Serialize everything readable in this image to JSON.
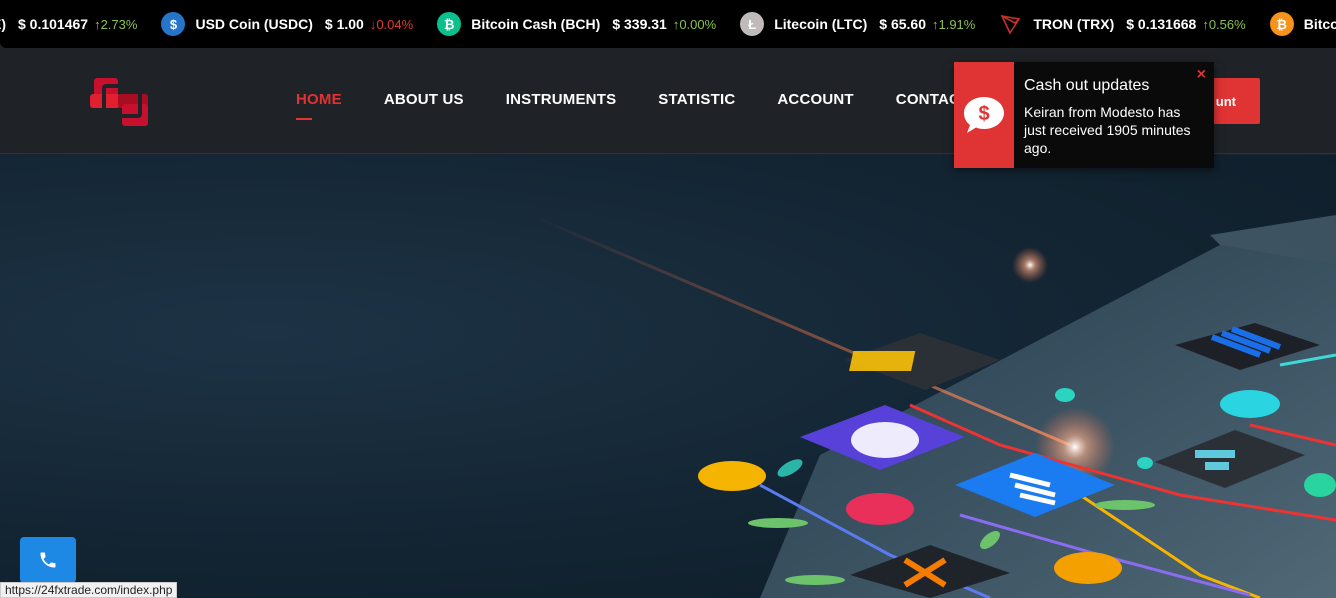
{
  "ticker": [
    {
      "name": "E)",
      "price": "$ 0.101467",
      "change": "2.73%",
      "dir": "up",
      "icon": "",
      "color": "#000000"
    },
    {
      "name": "USD Coin (USDC)",
      "price": "$ 1.00",
      "change": "0.04%",
      "dir": "down",
      "icon": "usdc-icon",
      "color": "#2775ca"
    },
    {
      "name": "Bitcoin Cash (BCH)",
      "price": "$ 339.31",
      "change": "0.00%",
      "dir": "up",
      "icon": "bch-icon",
      "color": "#0ac18e"
    },
    {
      "name": "Litecoin (LTC)",
      "price": "$ 65.60",
      "change": "1.91%",
      "dir": "up",
      "icon": "ltc-icon",
      "color": "#bfbbbb"
    },
    {
      "name": "TRON (TRX)",
      "price": "$ 0.131668",
      "change": "0.56%",
      "dir": "up",
      "icon": "trx-icon",
      "color": "#c2312a"
    },
    {
      "name": "Bitco",
      "price": "",
      "change": "",
      "dir": "up",
      "icon": "btc-icon",
      "color": "#f7931a"
    }
  ],
  "nav": {
    "items": [
      "HOME",
      "ABOUT US",
      "INSTRUMENTS",
      "STATISTIC",
      "ACCOUNT",
      "CONTACT US"
    ],
    "active": "HOME",
    "account_button": "unt"
  },
  "toast": {
    "title": "Cash out updates",
    "text": "Keiran from Modesto has just received 1905 minutes ago.",
    "close": "×"
  },
  "status_url": "https://24fxtrade.com/index.php",
  "colors": {
    "accent": "#e03333",
    "ticker_up": "#8bc34a",
    "ticker_down": "#e53935",
    "call": "#1e88e5"
  }
}
